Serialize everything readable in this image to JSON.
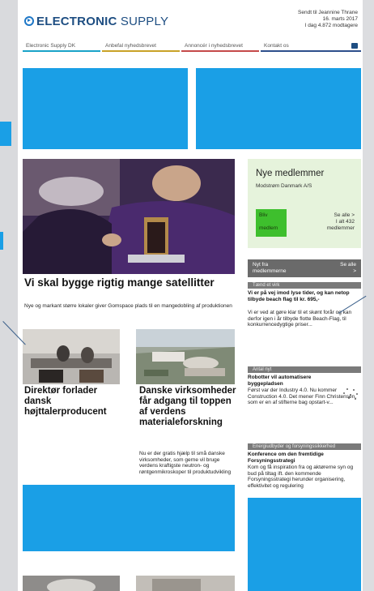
{
  "header": {
    "logo_bold": "ELECTRONIC",
    "logo_light": " SUPPLY",
    "sent_line1": "Sendt til Jeannine Thrane",
    "sent_line2": "16. marts 2017",
    "sent_line3": "I dag 4.872 modtagere"
  },
  "nav": {
    "items": [
      {
        "label": "Electronic Supply DK",
        "color": "#1aa3c8"
      },
      {
        "label": "Anbefal nyhedsbrevet",
        "color": "#c54a4a"
      },
      {
        "label": "Annoncér i nyhedsbrevet",
        "color": "#c54a4a"
      },
      {
        "label": "Kontakt os",
        "color": "#c54a4a"
      }
    ]
  },
  "colors": {
    "ad_blue": "#1a9fe6",
    "member_green": "#3ebf2d",
    "logo_blue": "#1e4e82"
  },
  "main": {
    "headline": "Vi skal bygge rigtig mange satellitter",
    "lead": "Nye og markant større lokaler giver Gomspace plads til en mangedobling af produktionen",
    "story2_title": "Direktør forlader dansk højttalerproducent",
    "story3_title": "Danske virksomheder får adgang til toppen af verdens materialeforskning",
    "story3_text": "Nu er der gratis hjælp til små danske virksomheder, som gerne vil bruge verdens kraftigste neutron- og røntgenmikroskoper til produktudvikling"
  },
  "sidebar": {
    "members_title": "Nye medlemmer",
    "members_company": "Modstrøm Danmark A/S",
    "btn_line1": "Bliv",
    "btn_line2": "medlem",
    "see_all_1": "Se alle >",
    "see_all_2": "I alt 432",
    "see_all_3": "medlemmer",
    "news_head_left": "Nyt fra",
    "news_head_left2": "medlemmerne",
    "news_head_right": "Se alle",
    "news_head_right2": ">",
    "section1": "Tænd et virk",
    "item1_title": "Vi er på vej imod lyse tider, og kan netop tilbyde beach flag til kr. 695,-",
    "item1_text": "Vi er ved at gøre klar til et skønt forår og kan derfor igen i år tilbyde flotte Beach-Flag, til konkurrencedygtige priser...",
    "section2": "Antal nyt",
    "item2_title": "Robotter vil automatisere byggepladsen",
    "item2_text": "Først var der Industry 4.0. Nu kommer Construction 4.0. Det mener Finn Christensen, som er en af stifterne bag opstart-v...",
    "section3": "Energiudbyder og forsyningssikkerhed",
    "item3_title": "Konference om den fremtidige Forsyningsstrategi",
    "item3_text": "Kom og få inspiration fra og aktørerne syn og bud på tiltag ift. den kommende Forsyningsstrategi herunder organisering, effektivitet og regulering"
  }
}
